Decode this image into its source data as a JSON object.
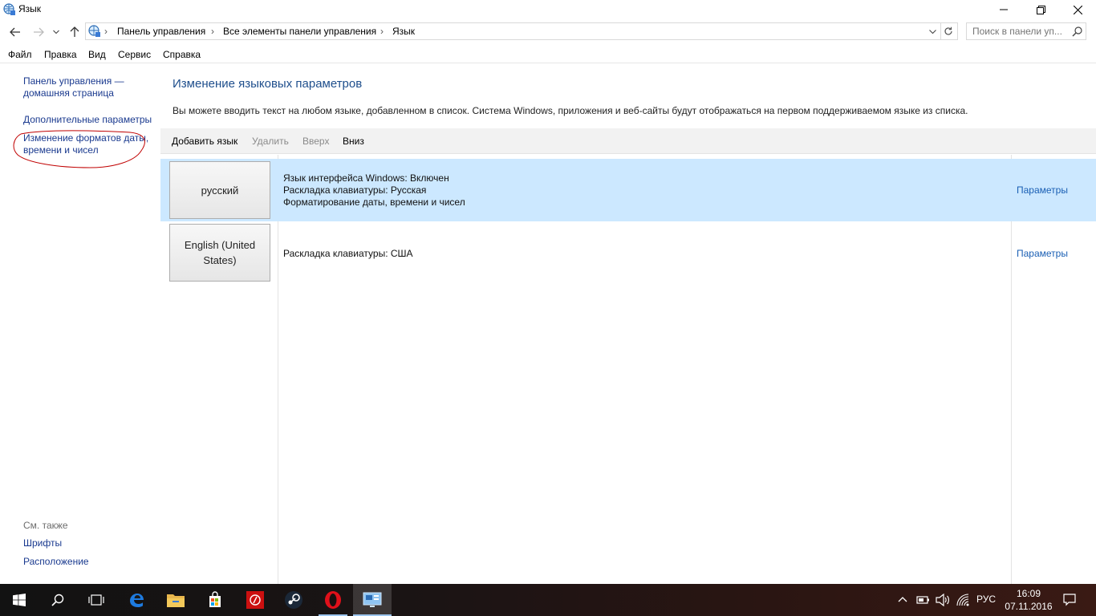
{
  "window": {
    "title": "Язык",
    "icon": "globe-control-panel-icon",
    "controls": [
      "minimize-icon",
      "maximize-icon",
      "close-icon"
    ]
  },
  "address": {
    "breadcrumbs": [
      "Панель управления",
      "Все элементы панели управления",
      "Язык"
    ],
    "search_placeholder": "Поиск в панели уп..."
  },
  "menu": [
    "Файл",
    "Правка",
    "Вид",
    "Сервис",
    "Справка"
  ],
  "left_pane": {
    "home_link_line1": "Панель управления —",
    "home_link_line2": "домашняя страница",
    "advanced_link": "Дополнительные параметры",
    "formats_link_line1": "Изменение форматов даты,",
    "formats_link_line2": "времени и чисел",
    "see_also": "См. также",
    "fonts_link": "Шрифты",
    "location_link": "Расположение"
  },
  "main": {
    "heading": "Изменение языковых параметров",
    "description": "Вы можете вводить текст на любом языке, добавленном в список. Система Windows, приложения и веб-сайты будут отображаться на первом поддерживаемом языке из списка.",
    "toolbar": {
      "add": "Добавить язык",
      "remove": "Удалить",
      "up": "Вверх",
      "down": "Вниз"
    },
    "languages": [
      {
        "name": "русский",
        "details": [
          "Язык интерфейса Windows: Включен",
          "Раскладка клавиатуры: Русская",
          "Форматирование даты, времени и чисел"
        ],
        "options": "Параметры",
        "selected": true
      },
      {
        "name_line1": "English (United",
        "name_line2": "States)",
        "details": [
          "Раскладка клавиатуры: США"
        ],
        "options": "Параметры",
        "selected": false
      }
    ]
  },
  "taskbar": {
    "apps": [
      "windows-start-icon",
      "search-icon",
      "task-view-icon",
      "edge-icon",
      "file-explorer-icon",
      "store-icon",
      "red-app-icon",
      "steam-icon",
      "opera-icon",
      "control-panel-icon"
    ],
    "tray_icons": [
      "chevron-up-icon",
      "battery-icon",
      "volume-icon",
      "network-icon"
    ],
    "language": "РУС",
    "time": "16:09",
    "date": "07.11.2016",
    "notifications_icon": "action-center-icon"
  },
  "colors": {
    "selected_row": "#cce8ff",
    "link": "#1a3a8f",
    "heading": "#1e4e8c",
    "annotation_circle": "#c00000"
  }
}
